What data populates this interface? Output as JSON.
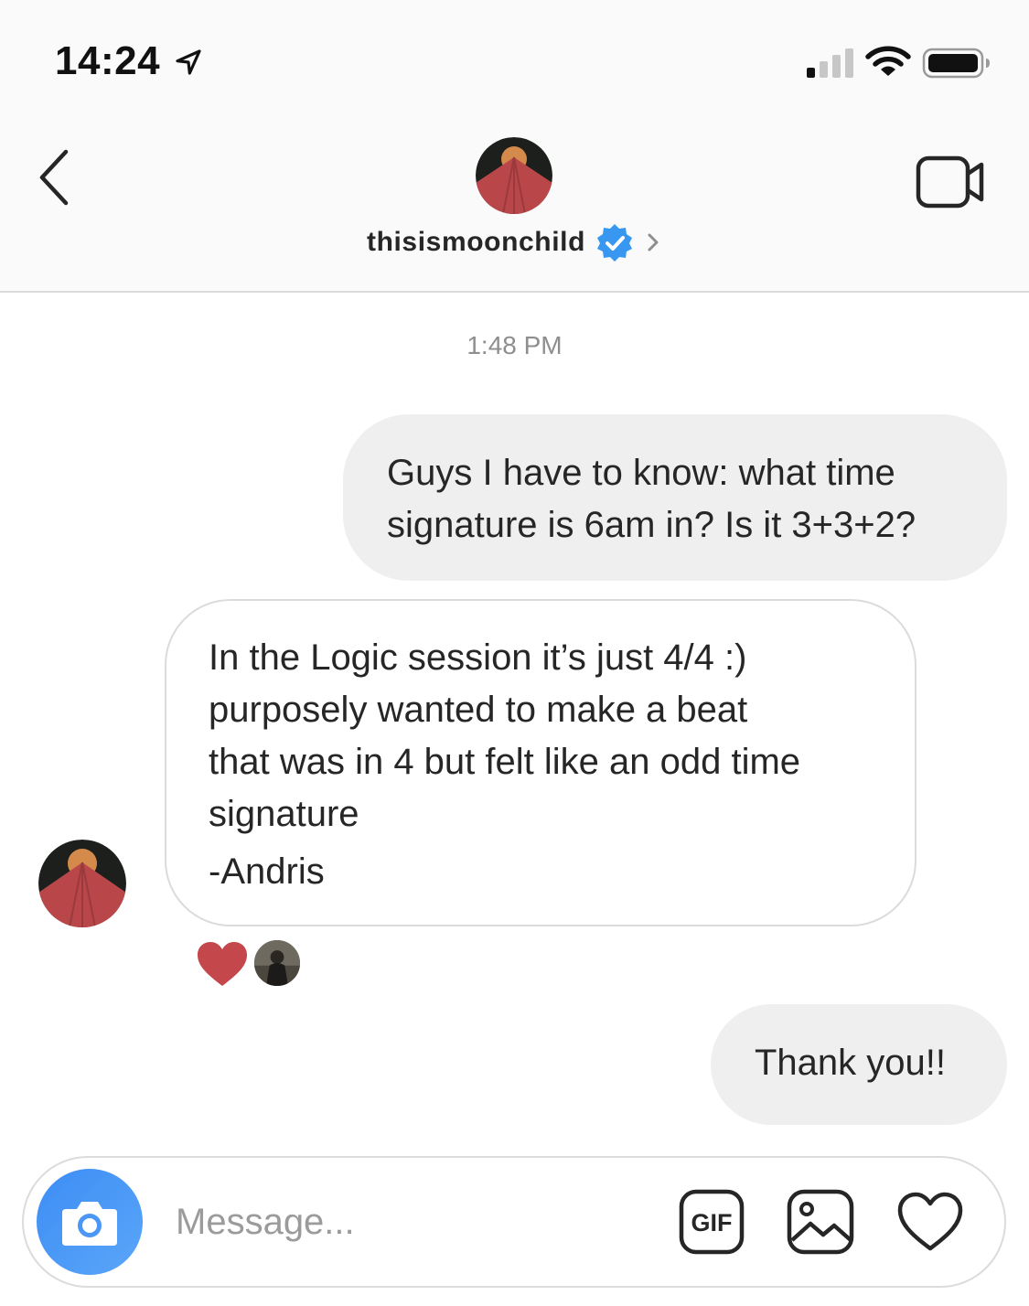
{
  "status_bar": {
    "time": "14:24",
    "location_icon": "location-arrow-icon",
    "signal_icon": "cellular-signal-icon",
    "wifi_icon": "wifi-icon",
    "battery_icon": "battery-icon"
  },
  "header": {
    "back_icon": "chevron-left-icon",
    "username": "thisismoonchild",
    "verified_icon": "verified-badge-icon",
    "chevron_icon": "chevron-right-icon",
    "video_call_icon": "video-camera-icon"
  },
  "conversation": {
    "timestamp": "1:48 PM",
    "messages": [
      {
        "direction": "outgoing",
        "text": "Guys I have to know: what time signature is 6am in? Is it 3+3+2?"
      },
      {
        "direction": "incoming",
        "lines": [
          "In the Logic session it’s just 4/4 :)",
          "purposely wanted to make a beat",
          "that was in 4 but felt like an odd time",
          "signature"
        ],
        "signoff": "-Andris",
        "reactions": [
          "heart-reaction-icon",
          "reactor-avatar"
        ]
      },
      {
        "direction": "outgoing",
        "text": "Thank you!!"
      }
    ]
  },
  "composer": {
    "camera_icon": "camera-icon",
    "placeholder": "Message...",
    "value": "",
    "gif_label": "GIF",
    "gallery_icon": "image-gallery-icon",
    "like_icon": "heart-icon"
  },
  "colors": {
    "accent_blue": "#3d8df5",
    "verified_blue": "#3897f0",
    "reaction_red": "#c4474b",
    "outgoing_bubble": "#efefef",
    "border_gray": "#dbdbdb"
  }
}
